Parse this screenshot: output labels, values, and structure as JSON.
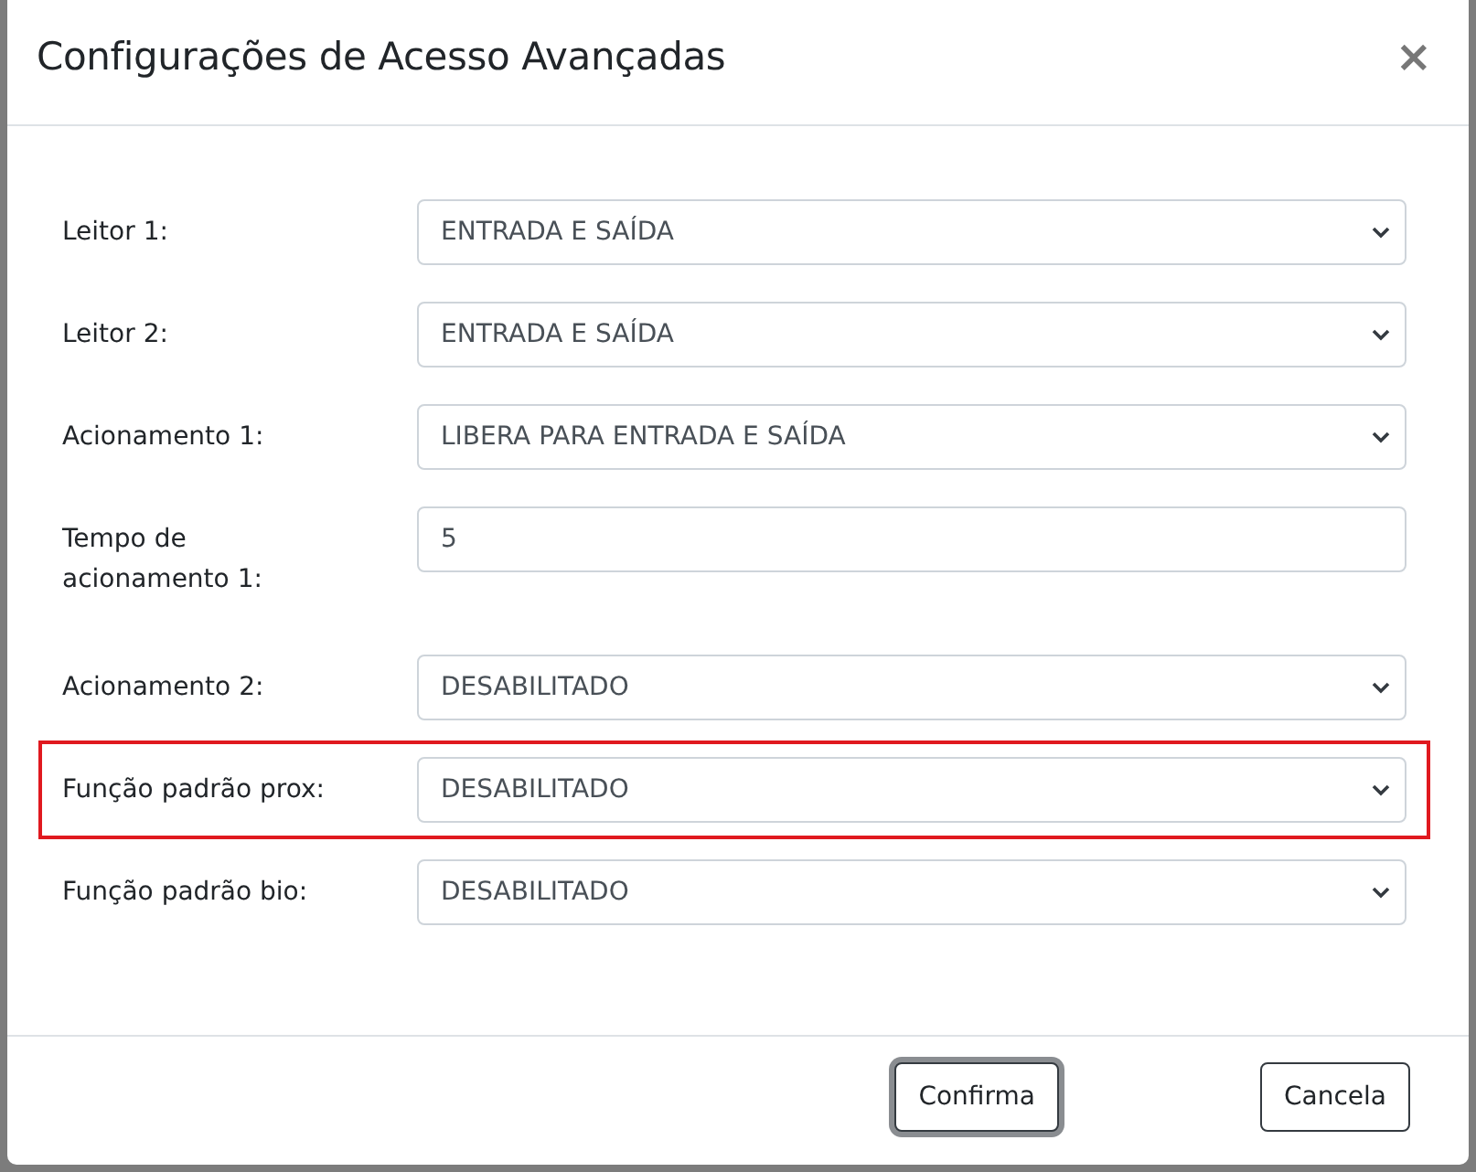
{
  "dialog": {
    "title": "Configurações de Acesso Avançadas",
    "close": "×"
  },
  "fields": [
    {
      "label": "Leitor 1:",
      "kind": "select",
      "value": "ENTRADA E SAÍDA",
      "highlighted": false
    },
    {
      "label": "Leitor 2:",
      "kind": "select",
      "value": "ENTRADA E SAÍDA",
      "highlighted": false
    },
    {
      "label": "Acionamento 1:",
      "kind": "select",
      "value": "LIBERA PARA ENTRADA E SAÍDA",
      "highlighted": false
    },
    {
      "label": "Tempo de acionamento 1:",
      "kind": "input",
      "value": "5",
      "highlighted": false
    },
    {
      "label": "Acionamento 2:",
      "kind": "select",
      "value": "DESABILITADO",
      "highlighted": false
    },
    {
      "label": "Função padrão prox:",
      "kind": "select",
      "value": "DESABILITADO",
      "highlighted": true
    },
    {
      "label": "Função padrão bio:",
      "kind": "select",
      "value": "DESABILITADO",
      "highlighted": false
    }
  ],
  "buttons": [
    {
      "label": "Confirma",
      "focused": true
    },
    {
      "label": "Cancela",
      "focused": false
    }
  ]
}
